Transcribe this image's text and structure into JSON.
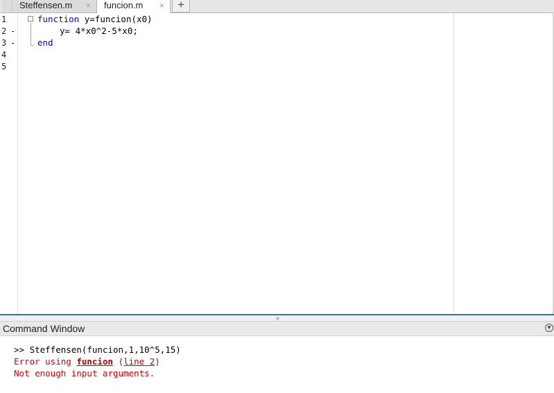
{
  "tabs": [
    {
      "label": "Steffensen.m",
      "close": "×"
    },
    {
      "label": "funcion.m",
      "close": "×"
    }
  ],
  "add_tab": "+",
  "editor": {
    "line_numbers": [
      "1",
      "2",
      "3",
      "4",
      "5"
    ],
    "breakpoint_markers": [
      "-",
      "-",
      "-"
    ],
    "fold_marker": "⊟",
    "lines": [
      {
        "kw": "function",
        "rest": " y=funcion(x0)"
      },
      {
        "kw": "",
        "rest": "y= 4*x0^2-5*x0;"
      },
      {
        "kw": "end",
        "rest": ""
      }
    ]
  },
  "command_window": {
    "title": "Command Window",
    "menu_icon": "chevron-down-icon",
    "prompt_line": ">> Steffensen(funcion,1,10^5,15)",
    "error_prefix": "Error using ",
    "error_func": "funcion",
    "error_paren_open": " (",
    "error_line_link": "line 2",
    "error_paren_close": ")",
    "error_message": "Not enough input arguments."
  }
}
